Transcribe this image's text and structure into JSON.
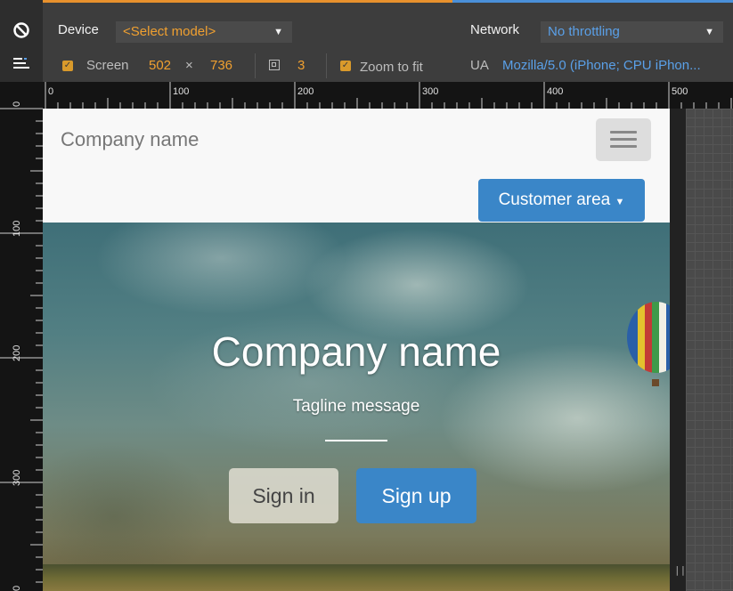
{
  "toolbar": {
    "device_label": "Device",
    "model_select": "<Select model>",
    "screen_label": "Screen",
    "screen_width": "502",
    "times": "×",
    "screen_height": "736",
    "dpr": "3",
    "zoom_label": "Zoom to fit",
    "network_label": "Network",
    "network_select": "No throttling",
    "ua_label": "UA",
    "ua_value": "Mozilla/5.0 (iPhone; CPU iPhon..."
  },
  "ruler": {
    "top_labels": [
      "0",
      "100",
      "200",
      "300",
      "400",
      "500"
    ],
    "left_labels": [
      "0",
      "100",
      "200",
      "300",
      "0"
    ]
  },
  "page": {
    "brand": "Company name",
    "customer_button": "Customer area",
    "hero_title": "Company name",
    "tagline": "Tagline message",
    "signin": "Sign in",
    "signup": "Sign up"
  },
  "colors": {
    "device_accent": "#e8912d",
    "network_accent": "#4a90d9",
    "primary_button": "#3a86c8"
  },
  "icons": [
    "no-entry-icon",
    "media-query-icon",
    "hamburger-icon",
    "caret-down-icon",
    "hot-air-balloon-icon",
    "resize-handle-icon"
  ]
}
